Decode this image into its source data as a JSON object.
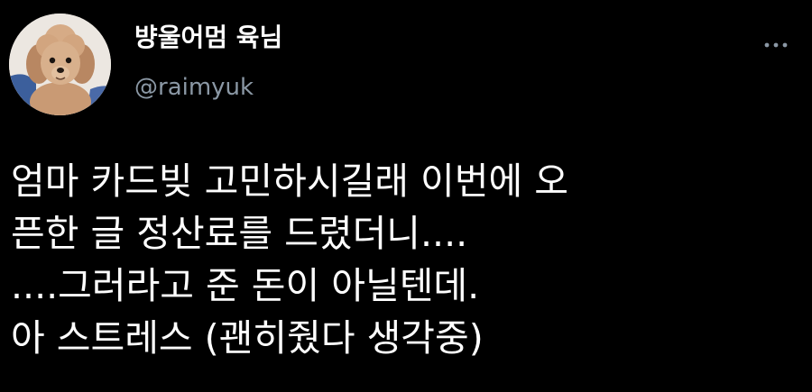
{
  "author": {
    "display_name": "뱡울어멈 육님",
    "handle": "@raimyuk",
    "avatar_icon": "poodle-dog-avatar"
  },
  "header": {
    "more_icon": "more-horizontal-icon"
  },
  "tweet": {
    "lines": [
      "엄마 카드빚 고민하시길래 이번에 오",
      "픈한 글 정산료를 드렸더니....",
      "....그러라고 준 돈이 아닐텐데.",
      "아 스트레스 (괜히줬다 생각중)"
    ]
  },
  "colors": {
    "background": "#000000",
    "text_primary": "#ffffff",
    "text_secondary": "#8b98a5"
  }
}
